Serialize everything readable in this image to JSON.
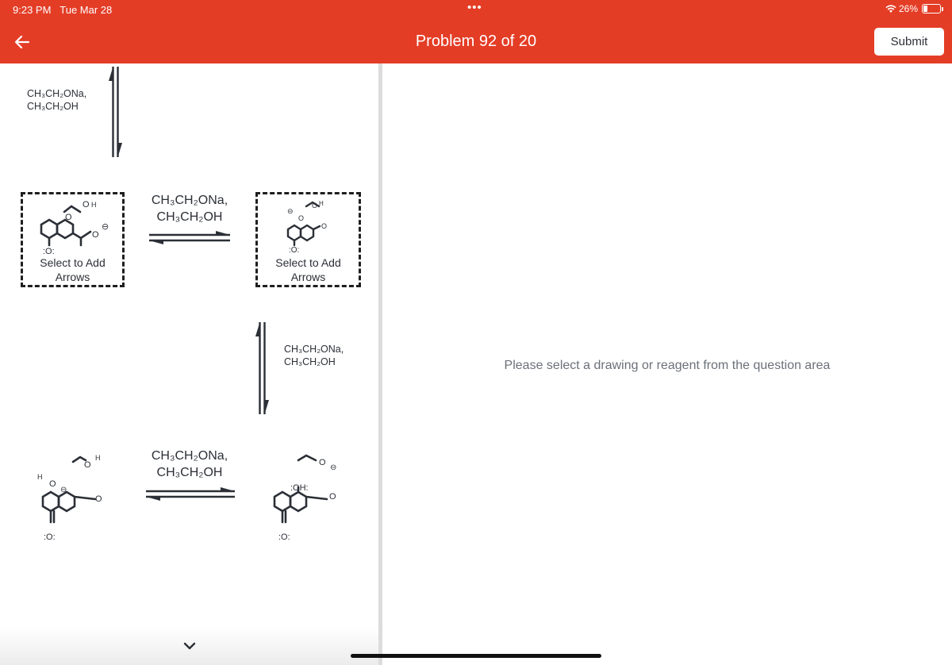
{
  "status_bar": {
    "time": "9:23 PM",
    "date": "Tue Mar 28",
    "dots": "•••",
    "battery": "26%",
    "battery_level": 0.26
  },
  "header": {
    "title": "Problem 92 of 20",
    "submit_label": "Submit"
  },
  "reagents": {
    "top_line1": "CH₃CH₂ONa,",
    "top_line2": "CH₃CH₂OH",
    "middle_line1": "CH₃CH₂ONa,",
    "middle_line2": "CH₃CH₂OH",
    "right_line1": "CH₃CH₂ONa,",
    "right_line2": "CH₃CH₂OH",
    "bottom_line1": "CH₃CH₂ONa,",
    "bottom_line2": "CH₃CH₂OH"
  },
  "boxes": {
    "left": {
      "line1": "Select to Add",
      "line2": "Arrows"
    },
    "right": {
      "line1": "Select to Add",
      "line2": "Arrows"
    }
  },
  "atoms": {
    "o": "O",
    "h": "H",
    "ring_o": ":O:",
    "oh": ":OH:",
    "minus": "⊖"
  },
  "placeholder": "Please select a drawing or reagent from the question area",
  "colors": {
    "accent": "#e43d26"
  }
}
